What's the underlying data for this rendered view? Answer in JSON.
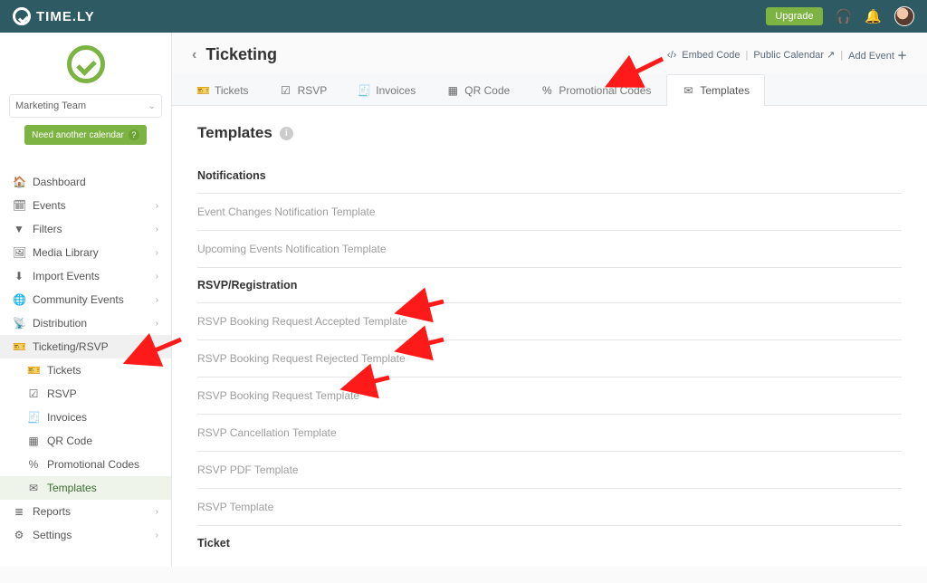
{
  "brand": "TIME.LY",
  "topbar": {
    "upgrade": "Upgrade"
  },
  "calendar_select": {
    "value": "Marketing Team"
  },
  "need_calendar": "Need another calendar",
  "sidebar": {
    "items": [
      {
        "icon": "home",
        "label": "Dashboard",
        "expand": false
      },
      {
        "icon": "cal",
        "label": "Events",
        "expand": true
      },
      {
        "icon": "filter",
        "label": "Filters",
        "expand": true
      },
      {
        "icon": "image",
        "label": "Media Library",
        "expand": true
      },
      {
        "icon": "download",
        "label": "Import Events",
        "expand": true
      },
      {
        "icon": "globe",
        "label": "Community Events",
        "expand": true
      },
      {
        "icon": "share",
        "label": "Distribution",
        "expand": true
      },
      {
        "icon": "ticket",
        "label": "Ticketing/RSVP",
        "expand": true,
        "active": true
      },
      {
        "icon": "list",
        "label": "Reports",
        "expand": true
      },
      {
        "icon": "gear",
        "label": "Settings",
        "expand": true
      }
    ],
    "ticketing_sub": [
      {
        "icon": "ticket",
        "label": "Tickets"
      },
      {
        "icon": "check",
        "label": "RSVP"
      },
      {
        "icon": "doc",
        "label": "Invoices"
      },
      {
        "icon": "qr",
        "label": "QR Code"
      },
      {
        "icon": "percent",
        "label": "Promotional Codes"
      },
      {
        "icon": "mail",
        "label": "Templates",
        "active": true
      }
    ]
  },
  "page": {
    "title": "Ticketing",
    "head_links": {
      "embed": "Embed Code",
      "public": "Public Calendar",
      "add": "Add Event"
    }
  },
  "tabs": [
    {
      "icon": "ticket",
      "label": "Tickets"
    },
    {
      "icon": "check",
      "label": "RSVP"
    },
    {
      "icon": "doc",
      "label": "Invoices"
    },
    {
      "icon": "qr",
      "label": "QR Code"
    },
    {
      "icon": "percent",
      "label": "Promotional Codes"
    },
    {
      "icon": "mail",
      "label": "Templates",
      "active": true
    }
  ],
  "section_title": "Templates",
  "groups": [
    {
      "heading": "Notifications",
      "rows": [
        "Event Changes Notification Template",
        "Upcoming Events Notification Template"
      ]
    },
    {
      "heading": "RSVP/Registration",
      "rows": [
        "RSVP Booking Request Accepted Template",
        "RSVP Booking Request Rejected Template",
        "RSVP Booking Request Template",
        "RSVP Cancellation Template",
        "RSVP PDF Template",
        "RSVP Template"
      ]
    },
    {
      "heading": "Ticket",
      "rows": []
    }
  ]
}
